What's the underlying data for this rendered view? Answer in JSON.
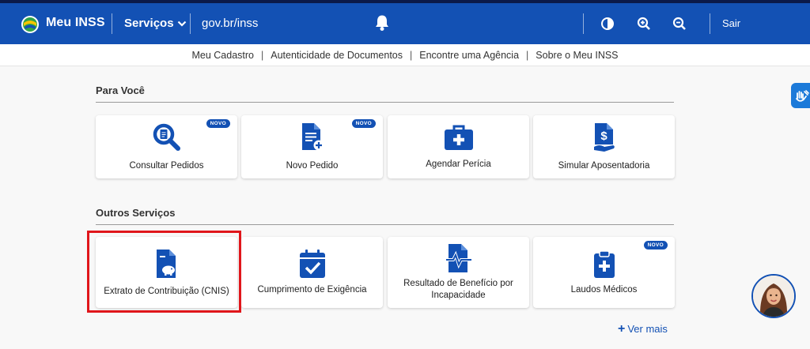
{
  "header": {
    "brand": "Meu INSS",
    "services_label": "Serviços",
    "govbr_label": "gov.br/inss",
    "sair_label": "Sair",
    "icons": [
      "notification-bell-icon",
      "contrast-icon",
      "zoom-in-icon",
      "zoom-out-icon"
    ]
  },
  "subnav": {
    "items": [
      "Meu Cadastro",
      "Autenticidade de Documentos",
      "Encontre uma Agência",
      "Sobre o Meu INSS"
    ],
    "separator": "|"
  },
  "para_voce": {
    "title": "Para Você",
    "cards": [
      {
        "label": "Consultar Pedidos",
        "badge": "NOVO",
        "icon": "search-document-icon"
      },
      {
        "label": "Novo Pedido",
        "badge": "NOVO",
        "icon": "new-document-icon"
      },
      {
        "label": "Agendar Perícia",
        "badge": "",
        "icon": "medical-bag-icon"
      },
      {
        "label": "Simular Aposentadoria",
        "badge": "",
        "icon": "money-document-icon"
      }
    ]
  },
  "outros_servicos": {
    "title": "Outros Serviços",
    "cards": [
      {
        "label": "Extrato de Contribuição (CNIS)",
        "badge": "",
        "icon": "piggy-bank-document-icon"
      },
      {
        "label": "Cumprimento de Exigência",
        "badge": "",
        "icon": "calendar-check-icon"
      },
      {
        "label": "Resultado de Benefício por Incapacidade",
        "badge": "",
        "icon": "health-document-icon"
      },
      {
        "label": "Laudos Médicos",
        "badge": "NOVO",
        "icon": "medical-clipboard-icon"
      }
    ]
  },
  "ver_mais_label": "Ver mais",
  "colors": {
    "primary": "#1351b4",
    "highlight": "#e0161b",
    "background": "#f8f8f8"
  }
}
